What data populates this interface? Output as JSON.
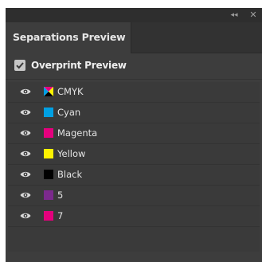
{
  "panel": {
    "tab_title": "Separations Preview",
    "collapse_glyph": "◂◂",
    "close_glyph": "✕"
  },
  "overprint": {
    "label": "Overprint Preview",
    "checked": true
  },
  "separations": [
    {
      "label": "CMYK",
      "swatch": "cmyk-composite",
      "visible": true
    },
    {
      "label": "Cyan",
      "color": "#00a0e3",
      "visible": true
    },
    {
      "label": "Magenta",
      "color": "#e5007e",
      "visible": true
    },
    {
      "label": "Yellow",
      "color": "#fff200",
      "visible": true
    },
    {
      "label": "Black",
      "color": "#000000",
      "visible": true
    },
    {
      "label": "5",
      "color": "#7b2a8c",
      "visible": true
    },
    {
      "label": "7",
      "color": "#e4007c",
      "visible": true
    }
  ],
  "colors": {
    "panel_bg": "#3d3d3d",
    "titlebar_bg": "#2e2e2e",
    "text": "#e4e4e4"
  },
  "icons": {
    "visibility": "eye-icon",
    "collapse": "double-chevron-left-icon",
    "close": "close-icon",
    "check": "checkmark-icon"
  }
}
